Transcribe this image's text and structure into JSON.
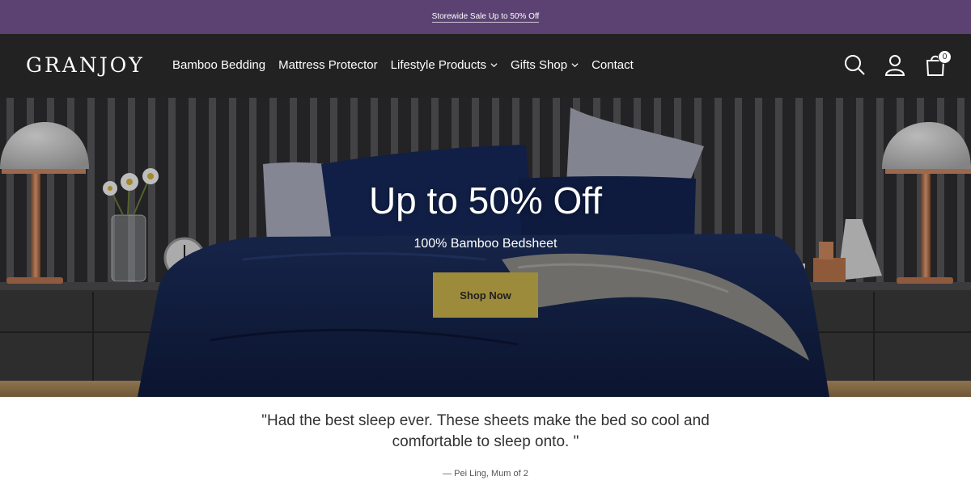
{
  "announcement": {
    "text": "Storewide Sale Up to 50% Off"
  },
  "brand": {
    "logo": "GRANJOY"
  },
  "nav": {
    "items": [
      {
        "label": "Bamboo Bedding"
      },
      {
        "label": "Mattress Protector"
      },
      {
        "label": "Lifestyle Products",
        "dropdown": true
      },
      {
        "label": "Gifts Shop",
        "dropdown": true
      },
      {
        "label": "Contact"
      }
    ]
  },
  "header_icons": {
    "search": "search-icon",
    "account": "user-icon",
    "cart": "bag-icon",
    "cart_count": "0"
  },
  "hero": {
    "title": "Up to 50% Off",
    "subtitle": "100% Bamboo Bedsheet",
    "cta": "Shop Now"
  },
  "testimonial": {
    "quote": "\"Had the best sleep ever. These sheets make the bed so cool and comfortable to sleep onto. \"",
    "author": "— Pei Ling, Mum of 2"
  },
  "colors": {
    "announcement_bg": "#5b4273",
    "header_bg": "#222222",
    "cta_bg": "#9c8b3a"
  }
}
